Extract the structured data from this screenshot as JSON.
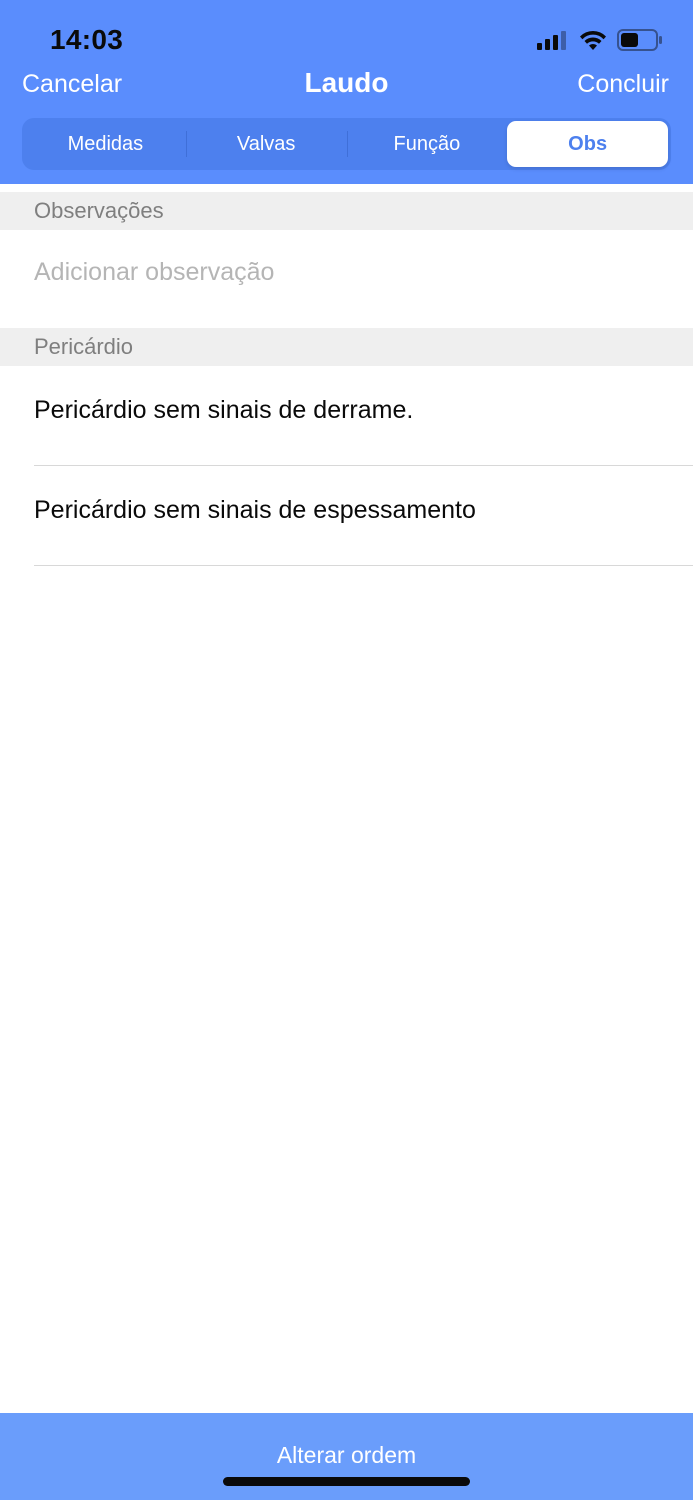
{
  "status_bar": {
    "time": "14:03",
    "icons": [
      "signal-icon",
      "wifi-icon",
      "battery-icon"
    ]
  },
  "nav": {
    "left": "Cancelar",
    "title": "Laudo",
    "right": "Concluir"
  },
  "segments": {
    "items": [
      {
        "label": "Medidas",
        "active": false
      },
      {
        "label": "Valvas",
        "active": false
      },
      {
        "label": "Função",
        "active": false
      },
      {
        "label": "Obs",
        "active": true
      }
    ]
  },
  "sections": {
    "observacoes": {
      "header": "Observações",
      "placeholder": "Adicionar observação"
    },
    "pericardio": {
      "header": "Pericárdio",
      "rows": [
        "Pericárdio sem sinais de derrame.",
        "Pericárdio sem sinais de espessamento"
      ]
    }
  },
  "bottom_bar": {
    "label": "Alterar ordem"
  },
  "colors": {
    "accent": "#5a8dfd",
    "bottom_bar": "#6a9dfb"
  }
}
